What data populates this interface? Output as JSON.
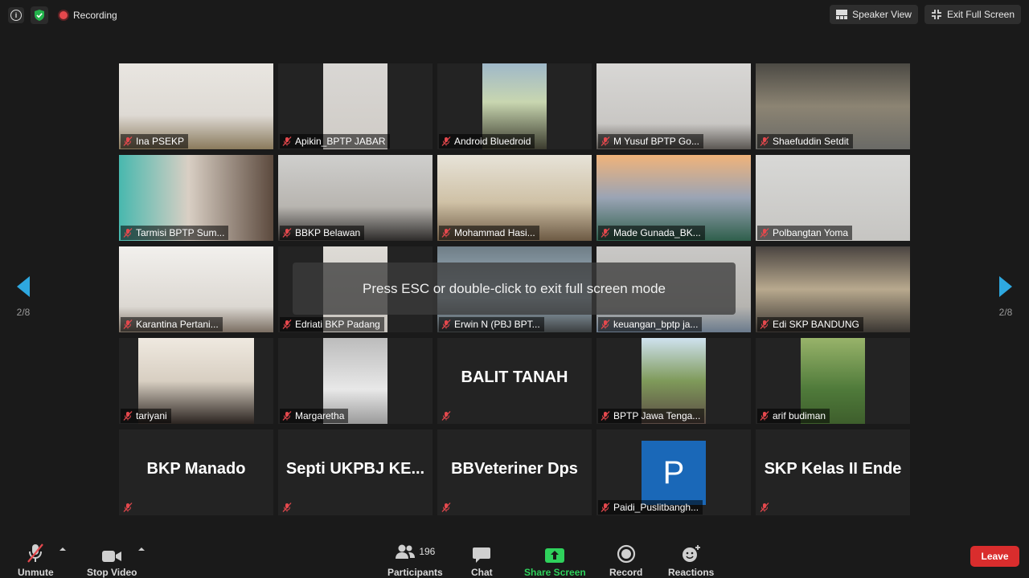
{
  "top": {
    "recording_label": "Recording",
    "speaker_view_label": "Speaker View",
    "exit_full_screen_label": "Exit Full Screen"
  },
  "tiles": [
    {
      "name": "Ina PSEKP"
    },
    {
      "name": "Apikin_BPTP JABAR"
    },
    {
      "name": "Android Bluedroid"
    },
    {
      "name": "M Yusuf BPTP Go..."
    },
    {
      "name": "Shaefuddin Setdit"
    },
    {
      "name": "Tarmisi BPTP Sum..."
    },
    {
      "name": "BBKP Belawan"
    },
    {
      "name": "Mohammad Hasi..."
    },
    {
      "name": "Made Gunada_BK..."
    },
    {
      "name": "Polbangtan Yoma"
    },
    {
      "name": "Karantina Pertani..."
    },
    {
      "name": "Edriati BKP Padang"
    },
    {
      "name": "Erwin N (PBJ BPT..."
    },
    {
      "name": "keuangan_bptp ja..."
    },
    {
      "name": "Edi SKP BANDUNG"
    },
    {
      "name": "tariyani"
    },
    {
      "name": "Margaretha"
    },
    {
      "name": "",
      "big": "BALIT TANAH"
    },
    {
      "name": "BPTP Jawa Tenga..."
    },
    {
      "name": "arif budiman"
    },
    {
      "name": "",
      "big": "BKP Manado"
    },
    {
      "name": "",
      "big": "Septi  UKPBJ  KE..."
    },
    {
      "name": "",
      "big": "BBVeteriner Dps"
    },
    {
      "name": "Paidi_Puslitbangh...",
      "avatar_letter": "P"
    },
    {
      "name": "",
      "big": "SKP Kelas II Ende"
    }
  ],
  "overlay_text": "Press ESC or double-click to exit full screen mode",
  "pager": {
    "left": "2/8",
    "right": "2/8"
  },
  "toolbar": {
    "unmute": "Unmute",
    "stop_video": "Stop Video",
    "participants": "Participants",
    "participants_count": "196",
    "chat": "Chat",
    "share_screen": "Share Screen",
    "record": "Record",
    "reactions": "Reactions",
    "leave": "Leave"
  },
  "colors": {
    "accent": "#2eaadc",
    "share_green": "#2fd25c",
    "leave_red": "#d92d2d",
    "recording_red": "#e5484d"
  }
}
